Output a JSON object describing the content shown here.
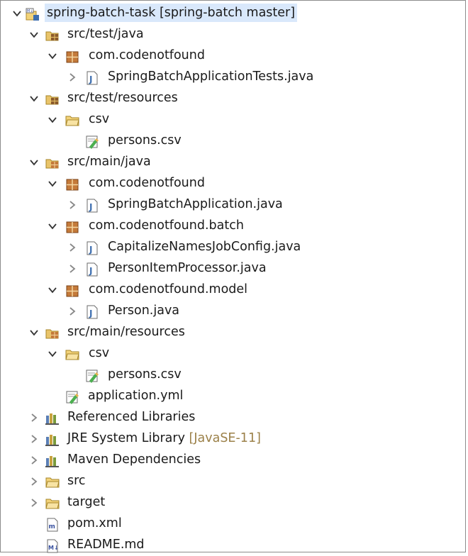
{
  "explorer": {
    "root": {
      "label": "spring-batch-task",
      "decoration": "[spring-batch master]"
    },
    "nodes": [
      {
        "label": "src/test/java"
      },
      {
        "label": "com.codenotfound"
      },
      {
        "label": "SpringBatchApplicationTests.java"
      },
      {
        "label": "src/test/resources"
      },
      {
        "label": "csv"
      },
      {
        "label": "persons.csv"
      },
      {
        "label": "src/main/java"
      },
      {
        "label": "com.codenotfound"
      },
      {
        "label": "SpringBatchApplication.java"
      },
      {
        "label": "com.codenotfound.batch"
      },
      {
        "label": "CapitalizeNamesJobConfig.java"
      },
      {
        "label": "PersonItemProcessor.java"
      },
      {
        "label": "com.codenotfound.model"
      },
      {
        "label": "Person.java"
      },
      {
        "label": "src/main/resources"
      },
      {
        "label": "csv"
      },
      {
        "label": "persons.csv"
      },
      {
        "label": "application.yml"
      },
      {
        "label": "Referenced Libraries"
      },
      {
        "label": "JRE System Library",
        "decoration": "[JavaSE-11]"
      },
      {
        "label": "Maven Dependencies"
      },
      {
        "label": "src"
      },
      {
        "label": "target"
      },
      {
        "label": "pom.xml"
      },
      {
        "label": "README.md"
      }
    ]
  },
  "colors": {
    "selection": "#d9e8fb",
    "decoration": "#9b8048",
    "folder": "#e9c46a",
    "package": "#a0522d",
    "java": "#3e6fb0"
  },
  "icons": [
    "maven-project-icon",
    "source-folder-icon",
    "package-icon",
    "java-file-icon",
    "folder-icon",
    "csv-file-icon",
    "yml-file-icon",
    "library-icon",
    "xml-file-icon",
    "markdown-file-icon"
  ]
}
